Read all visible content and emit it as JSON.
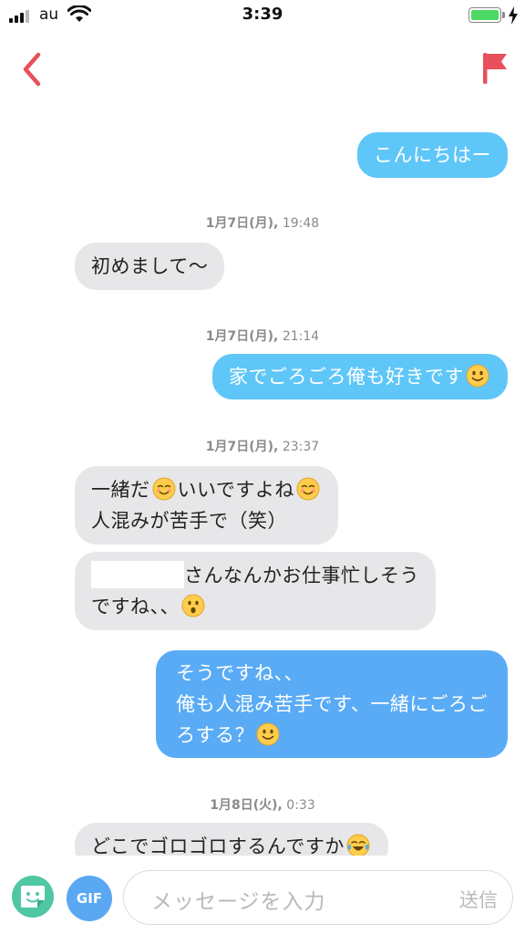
{
  "status_bar": {
    "carrier": "au",
    "time": "3:39"
  },
  "header": {
    "back_icon": "chevron-left-icon",
    "report_icon": "flag-icon",
    "accent_color": "#e8505b"
  },
  "messages": [
    {
      "direction": "out",
      "text": "こんにちはー"
    },
    {
      "timestamp_date": "1月7日(月),",
      "timestamp_time": "19:48"
    },
    {
      "direction": "in",
      "text": "初めまして〜"
    },
    {
      "timestamp_date": "1月7日(月),",
      "timestamp_time": "21:14"
    },
    {
      "direction": "out",
      "text": "家でごろごろ俺も好きです",
      "emoji": "slight-smile-emoji"
    },
    {
      "timestamp_date": "1月7日(月),",
      "timestamp_time": "23:37"
    },
    {
      "direction": "in",
      "line1_a": "一緒だ",
      "line1_b": "いいですよね",
      "line2": "人混みが苦手で（笑）",
      "emoji": "relieved-smile-emoji"
    },
    {
      "direction": "in",
      "line1": "さんなんかお仕事忙しそう",
      "line2": "ですね、、",
      "emoji": "hushed-face-emoji"
    },
    {
      "direction": "out",
      "line1": "そうですね、、",
      "line2": "俺も人混み苦手です、一緒にごろご",
      "line3": "ろする？",
      "emoji": "slight-smile-emoji"
    },
    {
      "timestamp_date": "1月8日(火),",
      "timestamp_time": "0:33"
    },
    {
      "direction": "in",
      "text": "どこでゴロゴロするんですか",
      "emoji": "tears-of-joy-emoji"
    }
  ],
  "composer": {
    "sticker_icon": "sticker-icon",
    "gif_label": "GIF",
    "placeholder": "メッセージを入力",
    "send_label": "送信"
  },
  "colors": {
    "incoming_bubble": "#e7e7e9",
    "outgoing_bubble": "#5fc6f8",
    "outgoing_bubble_long": "#5aabf5",
    "sticker_button": "#4fc7a4",
    "gif_button": "#5aa7f2",
    "battery": "#4cd964"
  }
}
